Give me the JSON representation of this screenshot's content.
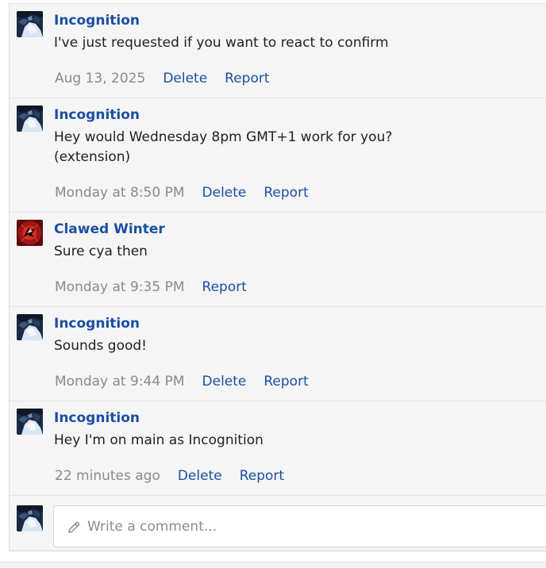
{
  "comments": [
    {
      "author": "Incognition",
      "avatar_icon": "incognition-avatar-icon",
      "text": "I've just requested if you want to react to confirm",
      "time": "Aug 13, 2025",
      "delete_label": "Delete",
      "report_label": "Report"
    },
    {
      "author": "Incognition",
      "avatar_icon": "incognition-avatar-icon",
      "text": "Hey would Wednesday 8pm GMT+1 work for you?\n(extension)",
      "time": "Monday at 8:50 PM",
      "delete_label": "Delete",
      "report_label": "Report"
    },
    {
      "author": "Clawed Winter",
      "avatar_icon": "clawed-winter-avatar-icon",
      "text": "Sure cya then",
      "time": "Monday at 9:35 PM",
      "report_label": "Report"
    },
    {
      "author": "Incognition",
      "avatar_icon": "incognition-avatar-icon",
      "text": "Sounds good!",
      "time": "Monday at 9:44 PM",
      "delete_label": "Delete",
      "report_label": "Report"
    },
    {
      "author": "Incognition",
      "avatar_icon": "incognition-avatar-icon",
      "text": "Hey I'm on main as Incognition",
      "time": "22 minutes ago",
      "delete_label": "Delete",
      "report_label": "Report"
    }
  ],
  "composer": {
    "placeholder": "Write a comment...",
    "avatar_icon": "incognition-avatar-icon",
    "pencil_icon": "pencil-icon"
  },
  "colors": {
    "author": "#1a4fa3",
    "action_link": "#1a4fa3",
    "timestamp": "#8a8a8a",
    "thread_background": "#f5f5f5"
  }
}
